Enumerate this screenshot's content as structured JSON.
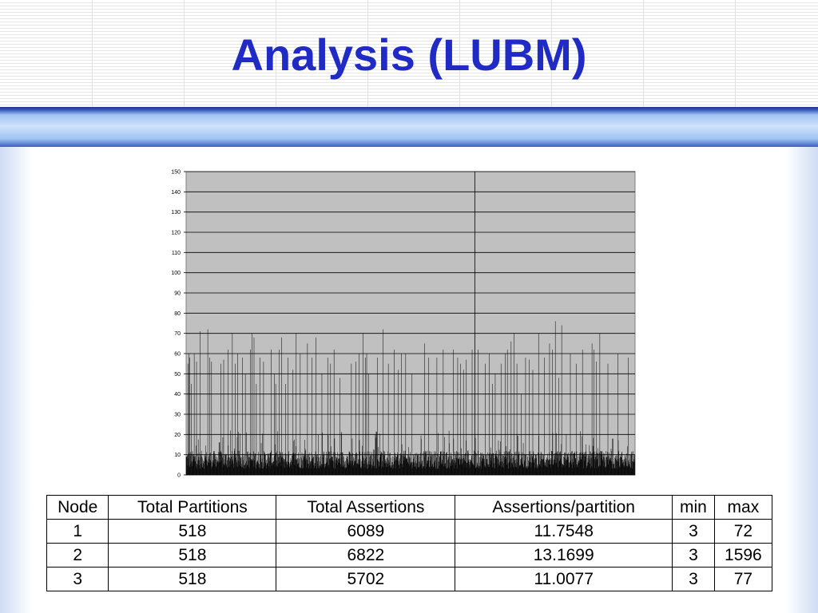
{
  "slide": {
    "title": "Analysis (LUBM)"
  },
  "colors": {
    "title": "#1f2bc4",
    "plot_background": "#c0c0c0",
    "bars": "#000000",
    "gridlines": "#000000"
  },
  "chart_data": {
    "type": "bar",
    "grid": true,
    "ylim": [
      0,
      150
    ],
    "yticks": [
      0,
      10,
      20,
      30,
      40,
      50,
      60,
      70,
      80,
      90,
      100,
      110,
      120,
      130,
      140,
      150
    ],
    "xlabel": "",
    "ylabel": "",
    "title": "",
    "series_count": 1554,
    "baseline_range": [
      3,
      12
    ],
    "spikes": [
      {
        "x": 6,
        "y": 55
      },
      {
        "x": 9,
        "y": 60
      },
      {
        "x": 12,
        "y": 58
      },
      {
        "x": 18,
        "y": 45
      },
      {
        "x": 28,
        "y": 60
      },
      {
        "x": 36,
        "y": 56
      },
      {
        "x": 48,
        "y": 71
      },
      {
        "x": 75,
        "y": 72
      },
      {
        "x": 82,
        "y": 58
      },
      {
        "x": 88,
        "y": 56
      },
      {
        "x": 120,
        "y": 55
      },
      {
        "x": 130,
        "y": 57
      },
      {
        "x": 145,
        "y": 62
      },
      {
        "x": 160,
        "y": 70
      },
      {
        "x": 170,
        "y": 55
      },
      {
        "x": 178,
        "y": 60
      },
      {
        "x": 195,
        "y": 58
      },
      {
        "x": 205,
        "y": 50
      },
      {
        "x": 222,
        "y": 62
      },
      {
        "x": 228,
        "y": 70
      },
      {
        "x": 235,
        "y": 68
      },
      {
        "x": 243,
        "y": 45
      },
      {
        "x": 255,
        "y": 58
      },
      {
        "x": 268,
        "y": 56
      },
      {
        "x": 295,
        "y": 62
      },
      {
        "x": 305,
        "y": 50
      },
      {
        "x": 310,
        "y": 45
      },
      {
        "x": 322,
        "y": 62
      },
      {
        "x": 330,
        "y": 68
      },
      {
        "x": 345,
        "y": 45
      },
      {
        "x": 352,
        "y": 58
      },
      {
        "x": 370,
        "y": 52
      },
      {
        "x": 381,
        "y": 70
      },
      {
        "x": 395,
        "y": 60
      },
      {
        "x": 420,
        "y": 65
      },
      {
        "x": 435,
        "y": 58
      },
      {
        "x": 450,
        "y": 68
      },
      {
        "x": 470,
        "y": 50
      },
      {
        "x": 490,
        "y": 58
      },
      {
        "x": 500,
        "y": 55
      },
      {
        "x": 512,
        "y": 62
      },
      {
        "x": 532,
        "y": 48
      },
      {
        "x": 572,
        "y": 55
      },
      {
        "x": 588,
        "y": 56
      },
      {
        "x": 598,
        "y": 60
      },
      {
        "x": 612,
        "y": 70
      },
      {
        "x": 620,
        "y": 58
      },
      {
        "x": 625,
        "y": 60
      },
      {
        "x": 632,
        "y": 50
      },
      {
        "x": 662,
        "y": 58
      },
      {
        "x": 682,
        "y": 72
      },
      {
        "x": 700,
        "y": 55
      },
      {
        "x": 720,
        "y": 62
      },
      {
        "x": 735,
        "y": 52
      },
      {
        "x": 745,
        "y": 60
      },
      {
        "x": 760,
        "y": 60
      },
      {
        "x": 782,
        "y": 50
      },
      {
        "x": 825,
        "y": 65
      },
      {
        "x": 840,
        "y": 58
      },
      {
        "x": 868,
        "y": 58
      },
      {
        "x": 890,
        "y": 62
      },
      {
        "x": 925,
        "y": 62
      },
      {
        "x": 940,
        "y": 58
      },
      {
        "x": 950,
        "y": 55
      },
      {
        "x": 960,
        "y": 52
      },
      {
        "x": 970,
        "y": 57
      },
      {
        "x": 990,
        "y": 62
      },
      {
        "x": 1010,
        "y": 62
      },
      {
        "x": 1035,
        "y": 55
      },
      {
        "x": 1050,
        "y": 60
      },
      {
        "x": 1060,
        "y": 45
      },
      {
        "x": 1070,
        "y": 50
      },
      {
        "x": 1090,
        "y": 55
      },
      {
        "x": 1105,
        "y": 60
      },
      {
        "x": 1112,
        "y": 62
      },
      {
        "x": 1125,
        "y": 66
      },
      {
        "x": 1135,
        "y": 70
      },
      {
        "x": 1145,
        "y": 55
      },
      {
        "x": 1160,
        "y": 40
      },
      {
        "x": 1175,
        "y": 58
      },
      {
        "x": 1188,
        "y": 57
      },
      {
        "x": 1200,
        "y": 52
      },
      {
        "x": 1220,
        "y": 70
      },
      {
        "x": 1240,
        "y": 58
      },
      {
        "x": 1258,
        "y": 65
      },
      {
        "x": 1268,
        "y": 62
      },
      {
        "x": 1278,
        "y": 76
      },
      {
        "x": 1290,
        "y": 48
      },
      {
        "x": 1300,
        "y": 74
      },
      {
        "x": 1330,
        "y": 60
      },
      {
        "x": 1350,
        "y": 55
      },
      {
        "x": 1372,
        "y": 62
      },
      {
        "x": 1405,
        "y": 65
      },
      {
        "x": 1412,
        "y": 62
      },
      {
        "x": 1420,
        "y": 56
      },
      {
        "x": 1432,
        "y": 70
      },
      {
        "x": 1460,
        "y": 55
      },
      {
        "x": 1475,
        "y": 18
      },
      {
        "x": 1495,
        "y": 60
      },
      {
        "x": 1530,
        "y": 58
      }
    ]
  },
  "table": {
    "headers": [
      "Node",
      "Total Partitions",
      "Total Assertions",
      "Assertions/partition",
      "min",
      "max"
    ],
    "rows": [
      [
        "1",
        "518",
        "6089",
        "11.7548",
        "3",
        "72"
      ],
      [
        "2",
        "518",
        "6822",
        "13.1699",
        "3",
        "1596"
      ],
      [
        "3",
        "518",
        "5702",
        "11.0077",
        "3",
        "77"
      ]
    ]
  }
}
